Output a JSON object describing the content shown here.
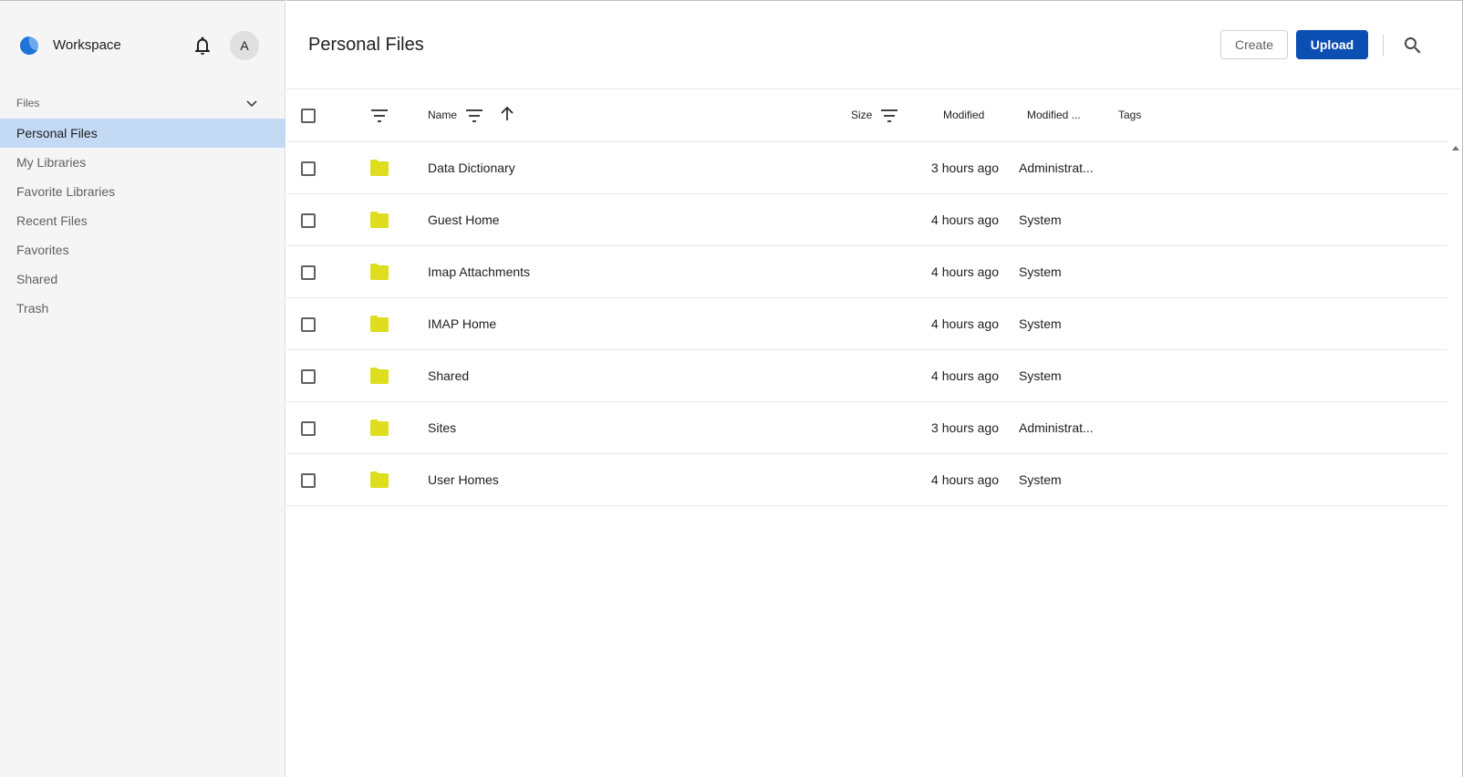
{
  "app": {
    "name": "Workspace",
    "avatar_initial": "A"
  },
  "sidebar": {
    "section_title": "Files",
    "items": [
      {
        "label": "Personal Files",
        "active": true
      },
      {
        "label": "My Libraries",
        "active": false
      },
      {
        "label": "Favorite Libraries",
        "active": false
      },
      {
        "label": "Recent Files",
        "active": false
      },
      {
        "label": "Favorites",
        "active": false
      },
      {
        "label": "Shared",
        "active": false
      },
      {
        "label": "Trash",
        "active": false
      }
    ]
  },
  "header": {
    "title": "Personal Files",
    "create_label": "Create",
    "upload_label": "Upload"
  },
  "table": {
    "columns": {
      "name": "Name",
      "size": "Size",
      "modified": "Modified",
      "modified_by": "Modified ...",
      "tags": "Tags"
    },
    "rows": [
      {
        "name": "Data Dictionary",
        "modified": "3 hours ago",
        "modified_by": "Administrat..."
      },
      {
        "name": "Guest Home",
        "modified": "4 hours ago",
        "modified_by": "System"
      },
      {
        "name": "Imap Attachments",
        "modified": "4 hours ago",
        "modified_by": "System"
      },
      {
        "name": "IMAP Home",
        "modified": "4 hours ago",
        "modified_by": "System"
      },
      {
        "name": "Shared",
        "modified": "4 hours ago",
        "modified_by": "System"
      },
      {
        "name": "Sites",
        "modified": "3 hours ago",
        "modified_by": "Administrat..."
      },
      {
        "name": "User Homes",
        "modified": "4 hours ago",
        "modified_by": "System"
      }
    ]
  },
  "colors": {
    "accent": "#0b4fb3",
    "active_nav": "#c4d9f3",
    "folder": "#dede1f",
    "logo": "#1e74d8"
  },
  "icons": [
    "app-logo-icon",
    "bell-icon",
    "chevron-down-icon",
    "search-icon",
    "filter-icon",
    "sort-arrow-up-icon",
    "folder-icon"
  ]
}
